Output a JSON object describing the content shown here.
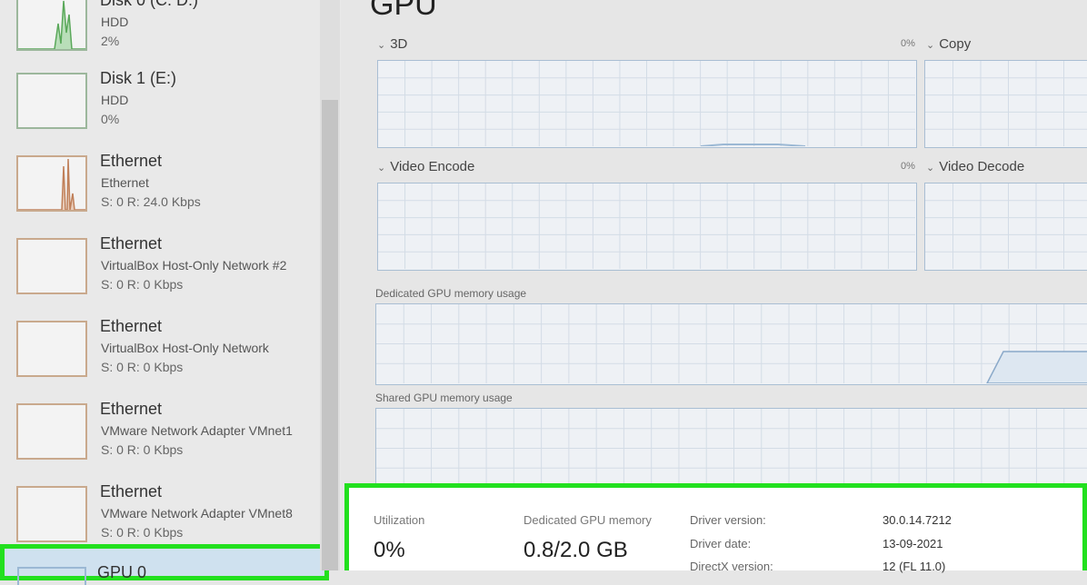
{
  "sidebar": {
    "items": [
      {
        "name": "Disk 0 (C: D:)",
        "sub": "HDD",
        "value": "2%"
      },
      {
        "name": "Disk 1 (E:)",
        "sub": "HDD",
        "value": "0%"
      },
      {
        "name": "Ethernet",
        "sub": "Ethernet",
        "value": "S: 0 R: 24.0 Kbps"
      },
      {
        "name": "Ethernet",
        "sub": "VirtualBox Host-Only Network #2",
        "value": "S: 0 R: 0 Kbps"
      },
      {
        "name": "Ethernet",
        "sub": "VirtualBox Host-Only Network",
        "value": "S: 0 R: 0 Kbps"
      },
      {
        "name": "Ethernet",
        "sub": "VMware Network Adapter VMnet1",
        "value": "S: 0 R: 0 Kbps"
      },
      {
        "name": "Ethernet",
        "sub": "VMware Network Adapter VMnet8",
        "value": "S: 0 R: 0 Kbps"
      },
      {
        "name": "GPU 0",
        "sub": "",
        "value": ""
      }
    ]
  },
  "main": {
    "title": "GPU",
    "graphs": {
      "g3d": {
        "label": "3D",
        "pct": "0%"
      },
      "copy": {
        "label": "Copy"
      },
      "video_encode": {
        "label": "Video Encode",
        "pct": "0%"
      },
      "video_decode": {
        "label": "Video Decode"
      },
      "dedicated_mem": {
        "label": "Dedicated GPU memory usage"
      },
      "shared_mem": {
        "label": "Shared GPU memory usage"
      }
    },
    "chevron": "⌄"
  },
  "details": {
    "utilization_label": "Utilization",
    "utilization_value": "0%",
    "dedicated_label": "Dedicated GPU memory",
    "dedicated_value": "0.8/2.0 GB",
    "props": [
      {
        "name": "Driver version:",
        "value": "30.0.14.7212"
      },
      {
        "name": "Driver date:",
        "value": "13-09-2021"
      },
      {
        "name": "DirectX version:",
        "value": "12 (FL 11.0)"
      }
    ]
  },
  "colors": {
    "highlight": "#22e01e",
    "graph_border": "#a9bed3",
    "disk_graph": "#5aa85a",
    "network_graph": "#c0805a"
  }
}
